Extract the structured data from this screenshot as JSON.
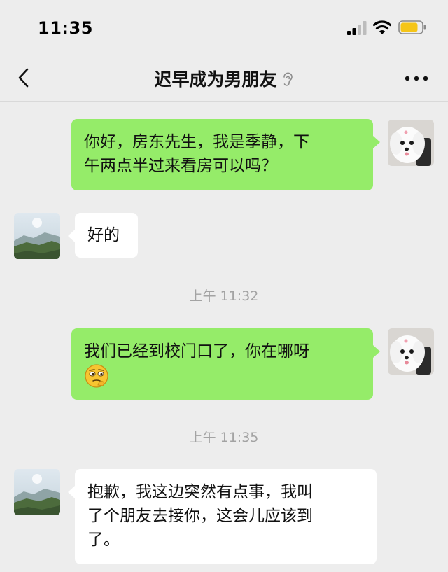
{
  "status_bar": {
    "time": "11:35",
    "icons": [
      "cellular-signal-icon",
      "wifi-icon",
      "battery-icon"
    ]
  },
  "header": {
    "title": "迟早成为男朋友",
    "icons": [
      "back-chevron-icon",
      "ear-mode-icon",
      "more-options-icon"
    ]
  },
  "colors": {
    "background": "#ededed",
    "sent_bubble": "#95ec69",
    "received_bubble": "#ffffff",
    "timestamp": "#a3a3a3",
    "battery_fill": "#f5c518"
  },
  "messages": [
    {
      "side": "me",
      "text_lines": [
        "你好，房东先生，我是季静，下",
        "午两点半过来看房可以吗？"
      ],
      "avatar": "white-dog-avatar"
    },
    {
      "side": "other",
      "text_lines": [
        "好的"
      ],
      "avatar": "landscape-avatar"
    },
    {
      "side": "me",
      "text_lines": [
        "我们已经到校门口了，你在哪呀"
      ],
      "emoji": "thinking-face-emoji",
      "avatar": "white-dog-avatar"
    },
    {
      "side": "other",
      "text_lines": [
        "抱歉，我这边突然有点事，我叫",
        "了个朋友去接你，这会儿应该到",
        "了。"
      ],
      "avatar": "landscape-avatar"
    }
  ],
  "timestamps": [
    "上午 11:32",
    "上午 11:35"
  ]
}
